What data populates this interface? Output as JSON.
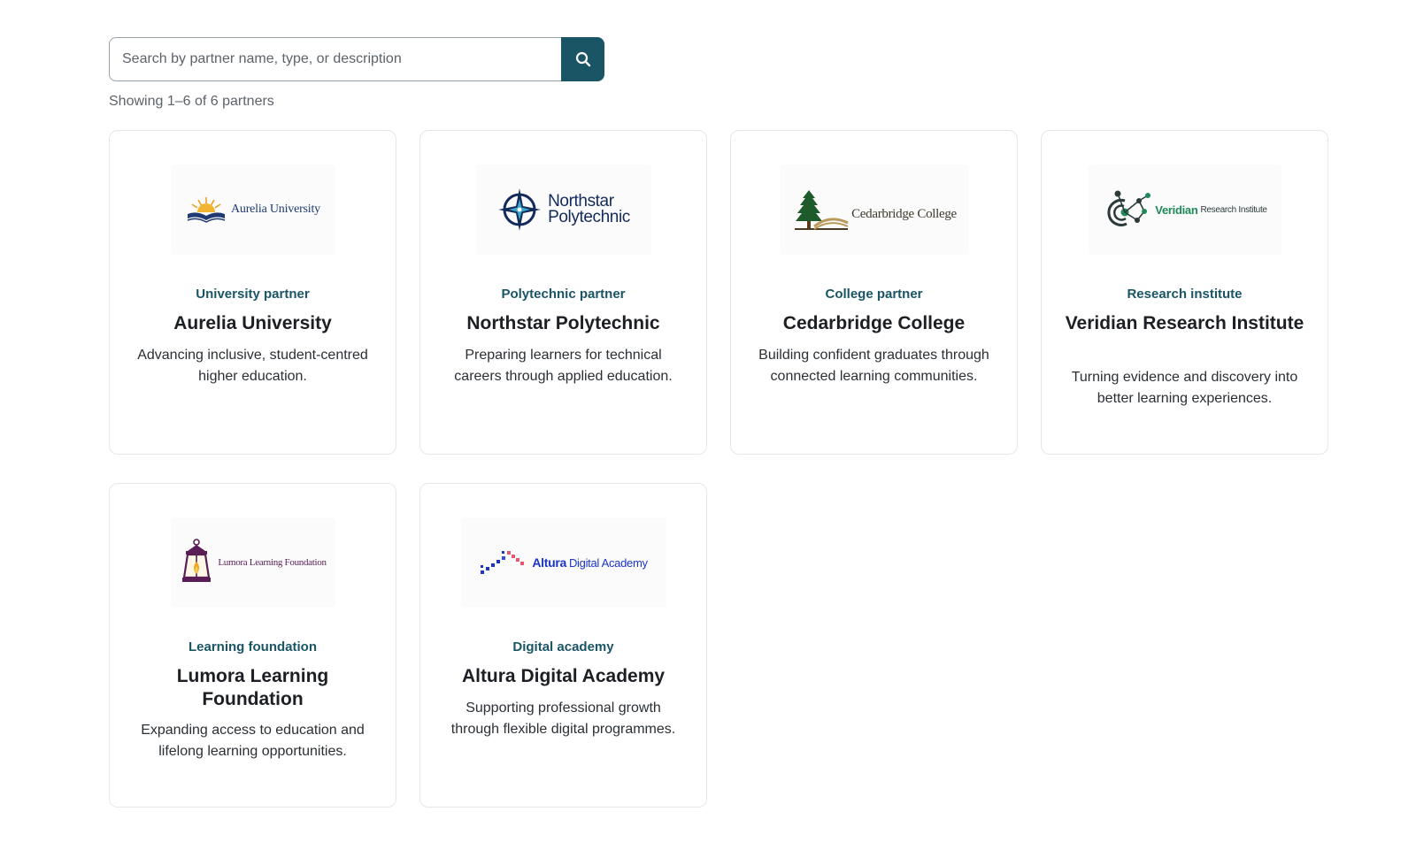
{
  "search": {
    "placeholder": "Search by partner name, type, or description",
    "button_icon": "search-icon"
  },
  "results": {
    "summary": "Showing 1–6 of 6 partners"
  },
  "colors": {
    "accent": "#1a5566",
    "card_border": "#e4e8ec"
  },
  "partners": [
    {
      "logo_text": "Aurelia University",
      "logo_icon": "open-book-sunrise-icon",
      "type": "University partner",
      "name": "Aurelia University",
      "description": "Advancing inclusive, student-centred higher education."
    },
    {
      "logo_text_line1": "Northstar",
      "logo_text_line2": "Polytechnic",
      "logo_icon": "compass-star-icon",
      "type": "Polytechnic partner",
      "name": "Northstar Polytechnic",
      "description": "Preparing learners for technical careers through applied education."
    },
    {
      "logo_text": "Cedarbridge College",
      "logo_icon": "cedar-tree-bridge-icon",
      "type": "College partner",
      "name": "Cedarbridge College",
      "description": "Building confident graduates through connected learning communities."
    },
    {
      "logo_text_main": "Veridian",
      "logo_text_rest": "Research Institute",
      "logo_icon": "molecule-network-icon",
      "type": "Research institute",
      "name": "Veridian Research Institute",
      "description": "Turning evidence and discovery into better learning experiences."
    },
    {
      "logo_text": "Lumora Learning Foundation",
      "logo_icon": "lantern-icon",
      "type": "Learning foundation",
      "name": "Lumora Learning Foundation",
      "description": "Expanding access to education and lifelong learning opportunities."
    },
    {
      "logo_text_main": "Altura",
      "logo_text_rest": "Digital Academy",
      "logo_icon": "pixel-steps-icon",
      "type": "Digital academy",
      "name": "Altura Digital Academy",
      "description": "Supporting professional growth through flexible digital programmes."
    }
  ]
}
